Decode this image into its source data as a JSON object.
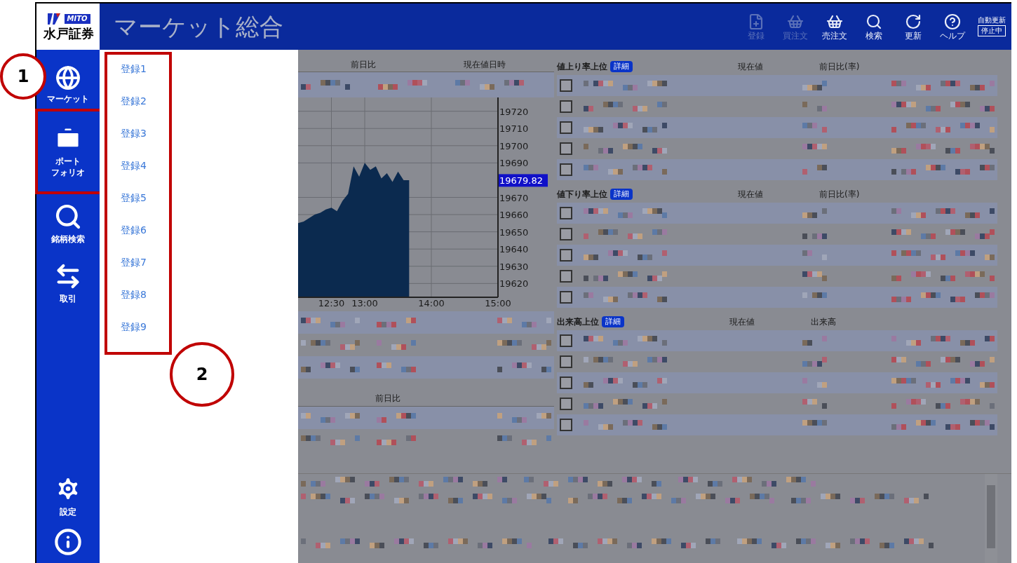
{
  "header": {
    "logo_text": "MITO",
    "brand": "水戸証券",
    "title": "マーケット総合",
    "toolbar": [
      {
        "label": "登録",
        "disabled": true
      },
      {
        "label": "買注文",
        "disabled": true
      },
      {
        "label": "売注文",
        "disabled": false
      },
      {
        "label": "検索",
        "disabled": false
      },
      {
        "label": "更新",
        "disabled": false
      },
      {
        "label": "ヘルプ",
        "disabled": false
      }
    ],
    "auto_update": {
      "label": "自動更新",
      "status": "停止中"
    }
  },
  "sidebar": {
    "items": [
      {
        "lines": [
          "マーケット"
        ]
      },
      {
        "lines": [
          "ポート",
          "フォリオ"
        ]
      },
      {
        "lines": [
          "銘柄検索"
        ]
      },
      {
        "lines": [
          "取引"
        ]
      }
    ],
    "bottom_items": [
      {
        "label": "設定"
      }
    ]
  },
  "portfolio_menu": {
    "items": [
      "登録1",
      "登録2",
      "登録3",
      "登録4",
      "登録5",
      "登録6",
      "登録7",
      "登録8",
      "登録9"
    ]
  },
  "index_panel": {
    "columns": [
      "前日比",
      "現在値日時"
    ],
    "price_label": "19679.82",
    "chart_data": {
      "type": "area",
      "categories": [
        null,
        null,
        null,
        null,
        null,
        null,
        "12:30",
        null,
        null,
        null,
        null,
        null,
        "13:00",
        null,
        null,
        null,
        null,
        null,
        null,
        null,
        null,
        null,
        null,
        null,
        "14:00",
        null,
        null,
        null,
        null,
        null,
        null,
        null,
        null,
        null,
        null,
        null,
        "15:00"
      ],
      "series": [
        {
          "color": "#0b2a4f",
          "values": [
            19655,
            19656,
            19658,
            19660,
            19661,
            19663,
            19664,
            19662,
            19668,
            19672,
            19688,
            19682,
            19690,
            19686,
            19688,
            19681,
            19684,
            19679,
            19685,
            19680,
            19680,
            null,
            null,
            null,
            null,
            null,
            null,
            null,
            null,
            null,
            null,
            null,
            null,
            null,
            null,
            null,
            null
          ]
        }
      ],
      "ylim": [
        19612,
        19728
      ],
      "grid": true,
      "yticks": [
        19620,
        19630,
        19640,
        19650,
        19660,
        19670,
        19690,
        19700,
        19710,
        19720
      ]
    }
  },
  "lower_panel": {
    "columns": [
      "前日比"
    ]
  },
  "rankings": [
    {
      "title": "値上り率上位",
      "detail": "詳細",
      "columns": [
        "現在値",
        "前日比(率)"
      ],
      "rows": [
        {
          "checked": false
        },
        {
          "checked": false
        },
        {
          "checked": false
        },
        {
          "checked": false
        },
        {
          "checked": false
        }
      ]
    },
    {
      "title": "値下り率上位",
      "detail": "詳細",
      "columns": [
        "現在値",
        "前日比(率)"
      ],
      "rows": [
        {
          "checked": false
        },
        {
          "checked": false
        },
        {
          "checked": false
        },
        {
          "checked": false
        },
        {
          "checked": false
        }
      ]
    },
    {
      "title": "出来高上位",
      "detail": "詳細",
      "columns": [
        "現在値",
        "出来高"
      ],
      "rows": [
        {
          "checked": false
        },
        {
          "checked": false
        },
        {
          "checked": false
        },
        {
          "checked": false
        },
        {
          "checked": false
        }
      ]
    }
  ],
  "annotations": [
    {
      "label": "1"
    },
    {
      "label": "2"
    }
  ]
}
